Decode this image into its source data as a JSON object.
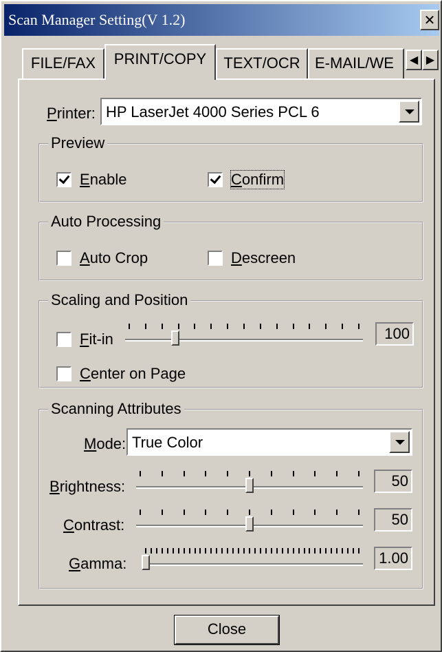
{
  "window": {
    "title": "Scan Manager Setting(V 1.2)",
    "close_glyph": "✕"
  },
  "tabs": [
    {
      "label": "FILE/FAX",
      "active": false
    },
    {
      "label": "PRINT/COPY",
      "active": true
    },
    {
      "label": "TEXT/OCR",
      "active": false
    },
    {
      "label": "E-MAIL/WE",
      "active": false
    }
  ],
  "tab_scroll": {
    "left_glyph": "◀",
    "right_glyph": "▶"
  },
  "printer": {
    "label_u": "P",
    "label_rest": "rinter:",
    "value": "HP LaserJet 4000 Series PCL 6"
  },
  "preview": {
    "title": "Preview",
    "enable": {
      "label_u": "E",
      "label_rest": "nable",
      "checked": true
    },
    "confirm": {
      "label_u": "C",
      "label_rest": "onfirm",
      "checked": true
    }
  },
  "auto_processing": {
    "title": "Auto Processing",
    "auto_crop": {
      "label_u": "A",
      "label_rest": "uto Crop",
      "checked": false
    },
    "descreen": {
      "label_u": "D",
      "label_rest": "escreen",
      "checked": false
    }
  },
  "scaling": {
    "title": "Scaling and Position",
    "fit_in": {
      "label_u": "F",
      "label_rest": "it-in",
      "checked": false
    },
    "center_on_page": {
      "label_u": "C",
      "label_rest": "enter on Page",
      "checked": false
    },
    "value": "100",
    "slider_fraction": 0.2
  },
  "scanning": {
    "title": "Scanning Attributes",
    "mode": {
      "label_u": "M",
      "label_rest": "ode:",
      "value": "True Color"
    },
    "brightness": {
      "label_u": "B",
      "label_rest": "rightness:",
      "value": "50",
      "slider_fraction": 0.5
    },
    "contrast": {
      "label_u": "C",
      "label_rest": "ontrast:",
      "value": "50",
      "slider_fraction": 0.5
    },
    "gamma": {
      "label_u": "G",
      "label_rest": "amma:",
      "value": "1.00",
      "slider_fraction": 0.0
    }
  },
  "close_button": {
    "label": "Close"
  }
}
